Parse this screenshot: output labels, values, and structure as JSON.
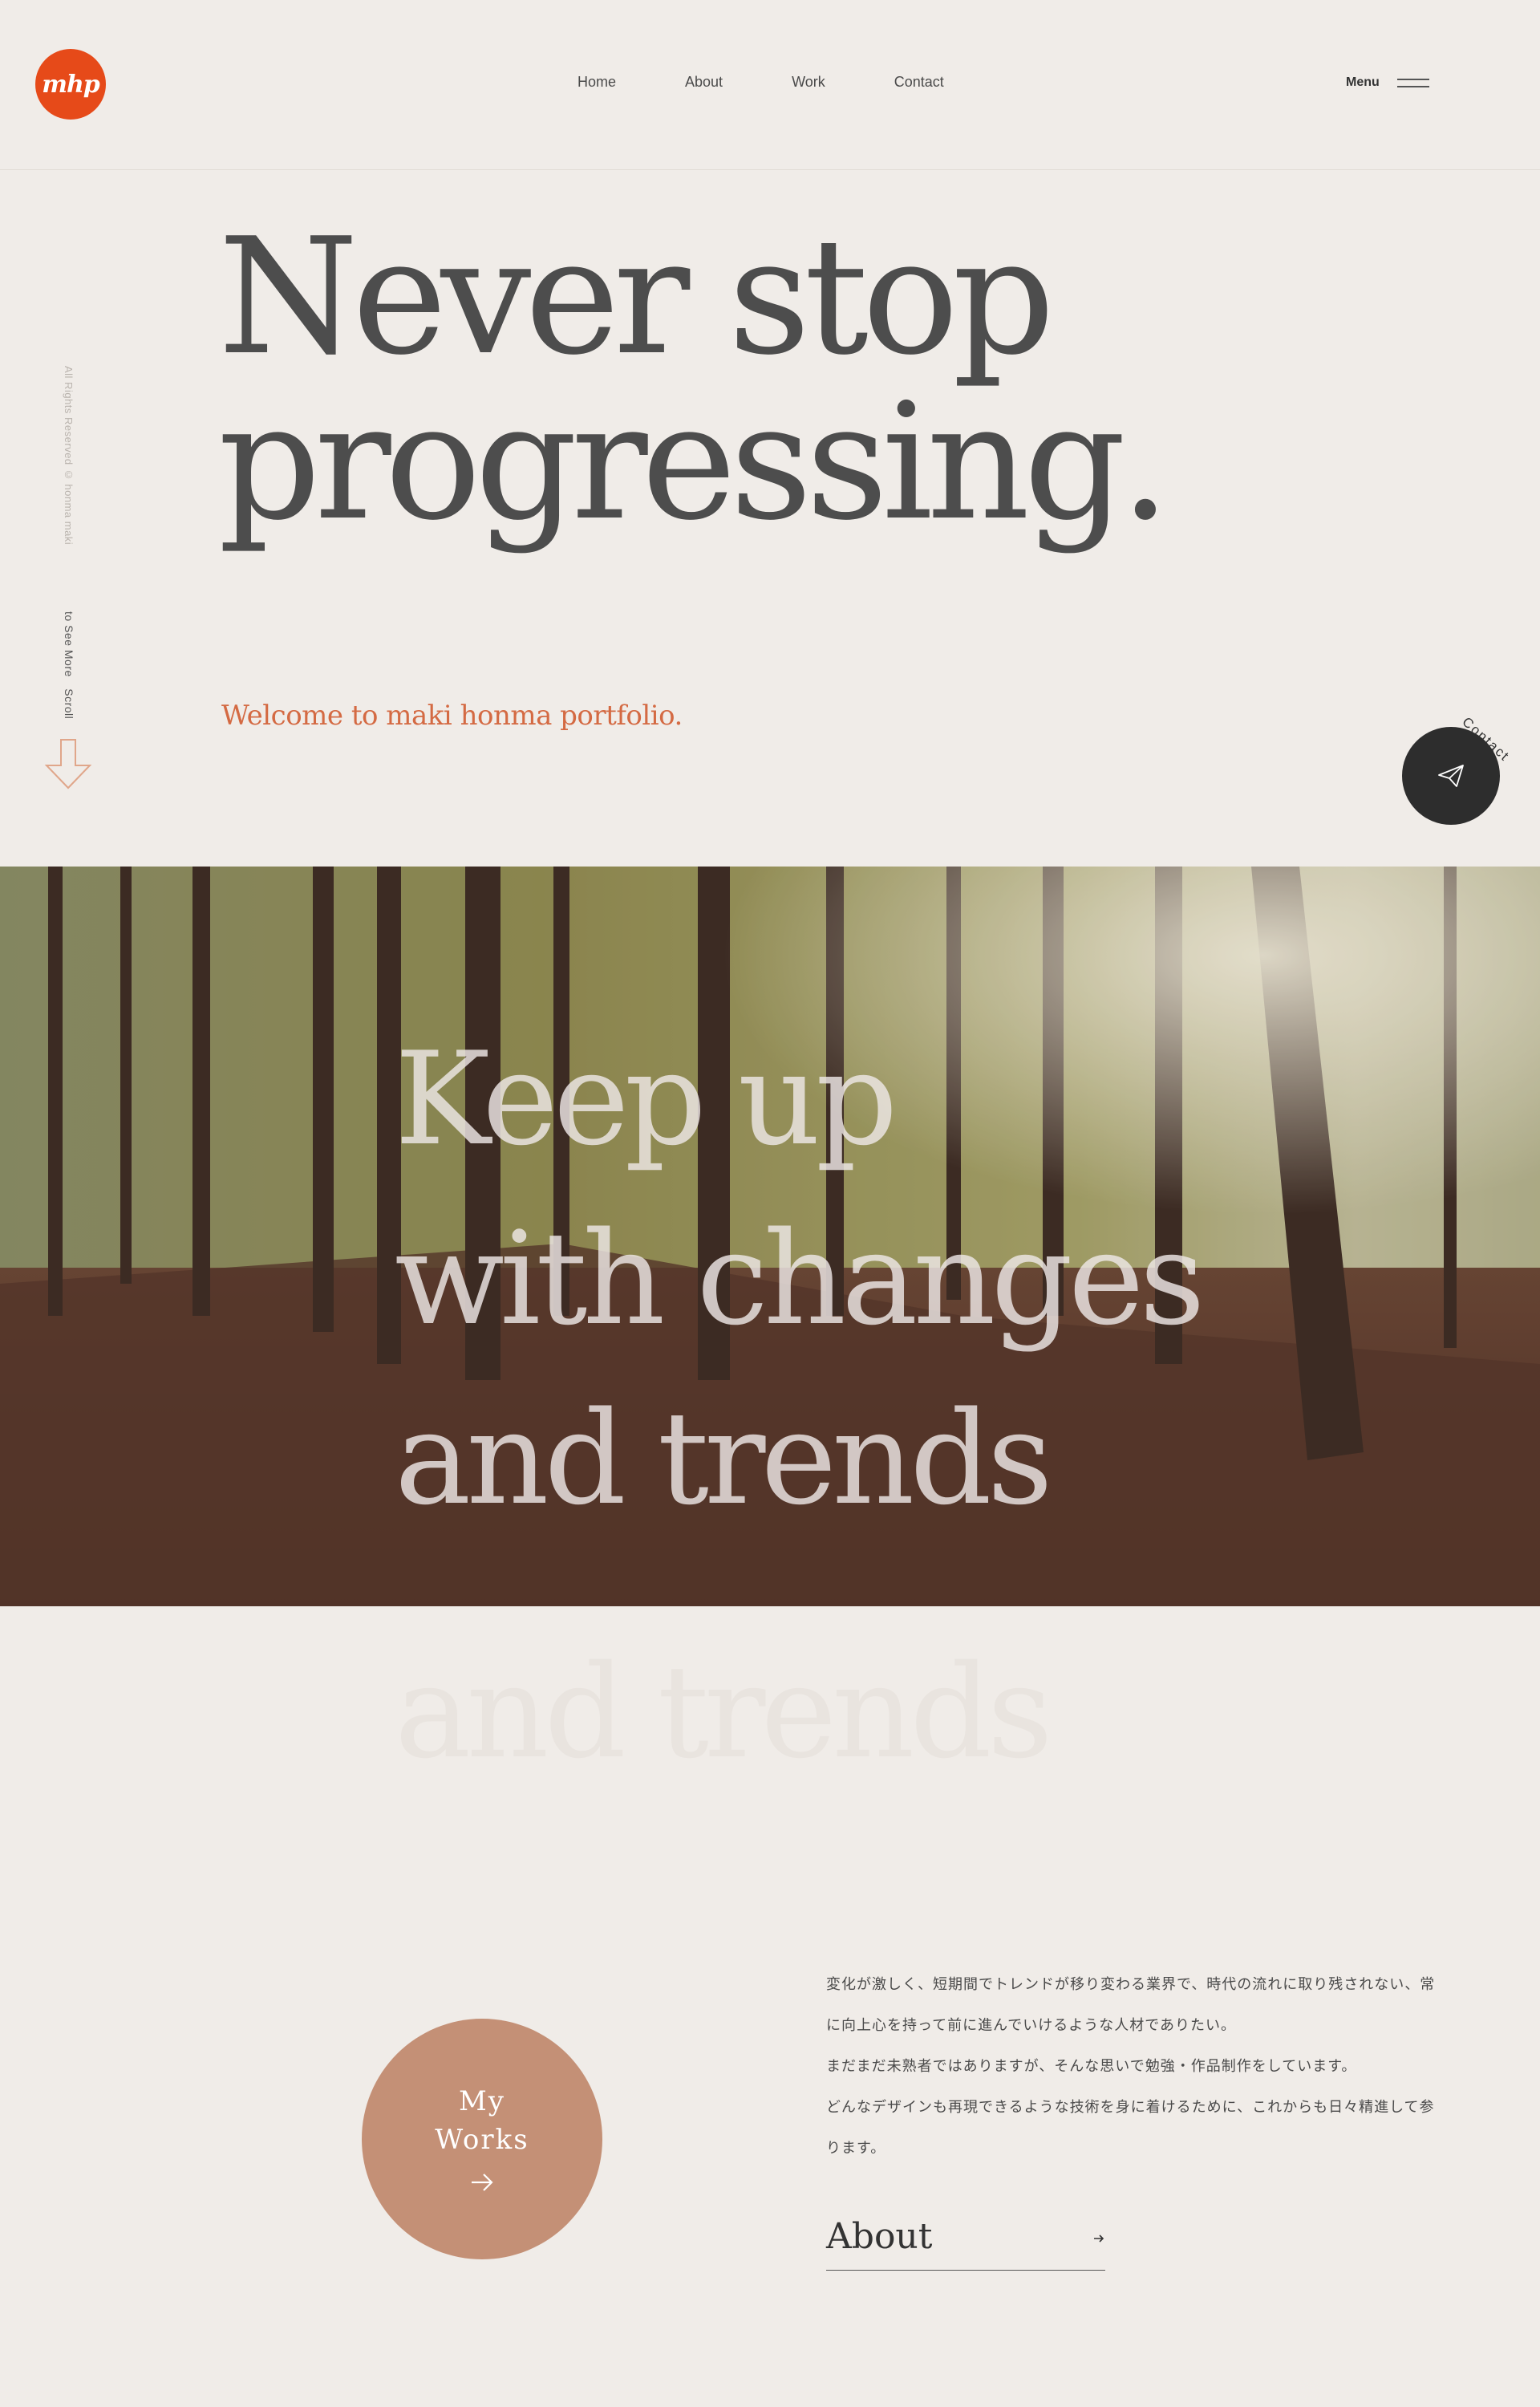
{
  "header": {
    "logo_text": "mhp",
    "nav": [
      {
        "label": "Home"
      },
      {
        "label": "About"
      },
      {
        "label": "Work"
      },
      {
        "label": "Contact"
      }
    ],
    "menu_label": "Menu"
  },
  "hero": {
    "title": "Never stop\nprogressing.",
    "welcome": "Welcome to maki honma portfolio."
  },
  "side": {
    "rights": "All Rights Reserved © honma maki",
    "scroll": "to See More　Scroll"
  },
  "contact_fab": {
    "label": "Contact",
    "icon": "paper-plane-icon"
  },
  "banner": {
    "title": "Keep up\nwith changes\nand trends",
    "ghost": "and trends"
  },
  "works": {
    "line1": "My",
    "line2": "Works"
  },
  "intro": {
    "lines": [
      "変化が激しく、短期間でトレンドが移り変わる業界で、時代の流れに取り残されない、常",
      "に向上心を持って前に進んでいけるような人材でありたい。",
      "まだまだ未熟者ではありますが、そんな思いで勉強・作品制作をしています。",
      "どんなデザインも再現できるような技術を身に着けるために、これからも日々精進して参",
      "ります。"
    ]
  },
  "about_link": {
    "label": "About"
  },
  "colors": {
    "background": "#f0ece8",
    "accent": "#e64a19",
    "welcome": "#d46a43",
    "works_circle": "#c49076",
    "fab": "#2d2d2d"
  }
}
